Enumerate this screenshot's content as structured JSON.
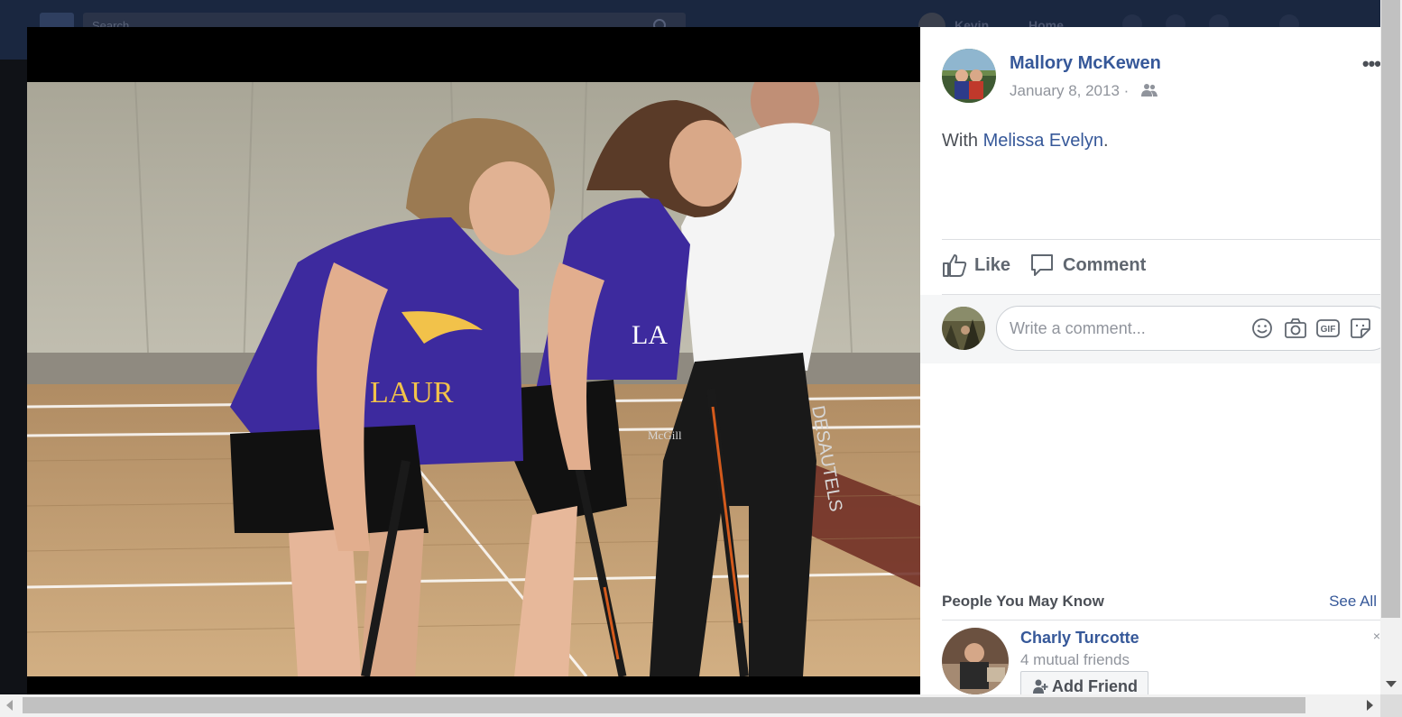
{
  "background": {
    "search_placeholder": "Search",
    "user_name": "Kevin",
    "home_label": "Home"
  },
  "post": {
    "author_name": "Mallory McKewen",
    "date": "January 8, 2013",
    "date_separator": "·",
    "audience_icon": "friends-icon",
    "more_label": "•••",
    "with_prefix": "With",
    "tagged_name": "Melissa Evelyn",
    "with_suffix": "."
  },
  "actions": {
    "like_label": "Like",
    "comment_label": "Comment"
  },
  "comment_box": {
    "placeholder": "Write a comment...",
    "icons": [
      "emoji-icon",
      "camera-icon",
      "gif-icon",
      "sticker-icon"
    ],
    "gif_text": "GIF"
  },
  "people_you_may_know": {
    "title": "People You May Know",
    "see_all_label": "See All",
    "suggestions": [
      {
        "name": "Charly Turcotte",
        "mutual": "4 mutual friends",
        "add_label": "Add Friend"
      }
    ]
  },
  "photo": {
    "jersey_text_left": "LAUR",
    "jersey_text_right": "LA",
    "pants_text": "DESAUTELS",
    "brand_text": "McGill"
  },
  "colors": {
    "link_blue": "#365899",
    "jersey_purple": "#3d2a9e",
    "court_wood": "#c9a577"
  }
}
